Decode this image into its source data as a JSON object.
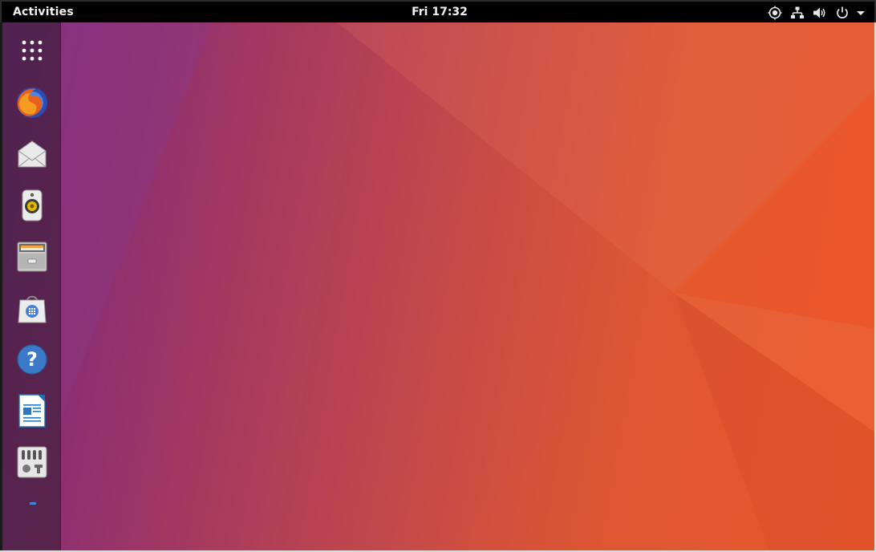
{
  "topbar": {
    "activities_label": "Activities",
    "clock": "Fri 17:32",
    "tray_icons": [
      "accessibility-icon",
      "network-icon",
      "volume-icon",
      "power-icon",
      "chevron-down-icon"
    ]
  },
  "dock": {
    "items": [
      {
        "name": "show-applications",
        "icon": "app-grid-icon"
      },
      {
        "name": "firefox",
        "icon": "firefox-icon"
      },
      {
        "name": "thunderbird-mail",
        "icon": "mail-icon"
      },
      {
        "name": "rhythmbox",
        "icon": "speaker-icon"
      },
      {
        "name": "files",
        "icon": "file-cabinet-icon"
      },
      {
        "name": "ubuntu-software",
        "icon": "shopping-bag-icon"
      },
      {
        "name": "help",
        "icon": "help-icon"
      },
      {
        "name": "libreoffice-writer",
        "icon": "writer-document-icon"
      },
      {
        "name": "settings",
        "icon": "settings-icon"
      }
    ],
    "running_indicator": "settings"
  },
  "colors": {
    "topbar": "#000000",
    "wallpaper_left": "#7c2d7e",
    "wallpaper_right": "#e9572a",
    "indicator": "#3d8ae4"
  }
}
